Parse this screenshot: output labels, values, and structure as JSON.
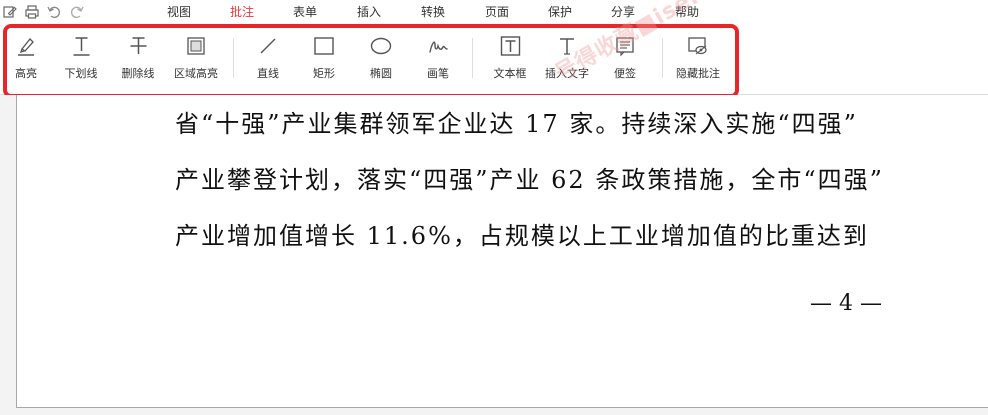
{
  "menubar": {
    "items": [
      {
        "label": "视图"
      },
      {
        "label": "批注",
        "active": true
      },
      {
        "label": "表单"
      },
      {
        "label": "插入"
      },
      {
        "label": "转换"
      },
      {
        "label": "页面"
      },
      {
        "label": "保护"
      },
      {
        "label": "分享"
      },
      {
        "label": "帮助"
      }
    ],
    "active_color": "#e23c3c"
  },
  "toolbar": {
    "tools": [
      {
        "label": "高亮",
        "icon": "highlighter-icon"
      },
      {
        "label": "下划线",
        "icon": "underline-icon"
      },
      {
        "label": "删除线",
        "icon": "strikethrough-icon"
      },
      {
        "label": "区域高亮",
        "icon": "area-highlight-icon"
      },
      {
        "label": "直线",
        "icon": "line-icon"
      },
      {
        "label": "矩形",
        "icon": "rectangle-icon"
      },
      {
        "label": "椭圆",
        "icon": "ellipse-icon"
      },
      {
        "label": "画笔",
        "icon": "pen-icon"
      },
      {
        "label": "文本框",
        "icon": "textbox-icon"
      },
      {
        "label": "插入文字",
        "icon": "insert-text-icon"
      },
      {
        "label": "便签",
        "icon": "sticky-note-icon"
      },
      {
        "label": "隐藏批注",
        "icon": "hide-annotations-icon"
      }
    ],
    "highlight_color": "#e5262b"
  },
  "watermark": {
    "text": "号得收藏■ise.com"
  },
  "document": {
    "lines": [
      "省“十强”产业集群领军企业达 17 家。持续深入实施“四强”",
      "产业攀登计划，落实“四强”产业 62 条政策措施，全市“四强”",
      "产业增加值增长 11.6%，占规模以上工业增加值的比重达到"
    ],
    "page_number": "— 4 —"
  }
}
